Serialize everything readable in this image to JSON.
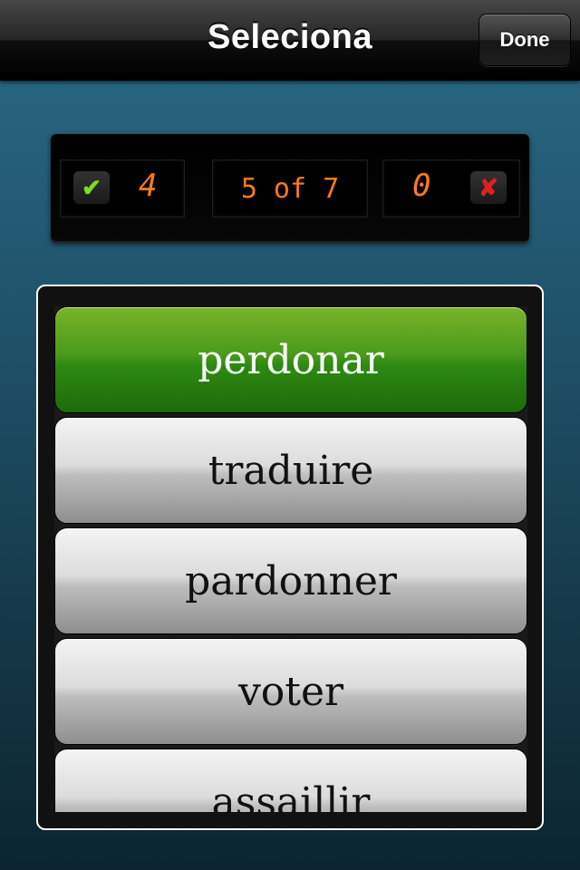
{
  "navbar": {
    "title": "Seleciona",
    "done_label": "Done"
  },
  "score": {
    "correct": "4",
    "progress": "5 of 7",
    "wrong": "0",
    "check_glyph": "✔",
    "cross_glyph": "✘"
  },
  "options": [
    {
      "label": "perdonar",
      "selected": true
    },
    {
      "label": "traduire",
      "selected": false
    },
    {
      "label": "pardonner",
      "selected": false
    },
    {
      "label": "voter",
      "selected": false
    },
    {
      "label": "assaillir",
      "selected": false
    }
  ],
  "colors": {
    "lcd_digit": "#ff7a1a",
    "selected_option": "#2e8a12",
    "check": "#7ddc1f",
    "cross": "#e02020"
  }
}
